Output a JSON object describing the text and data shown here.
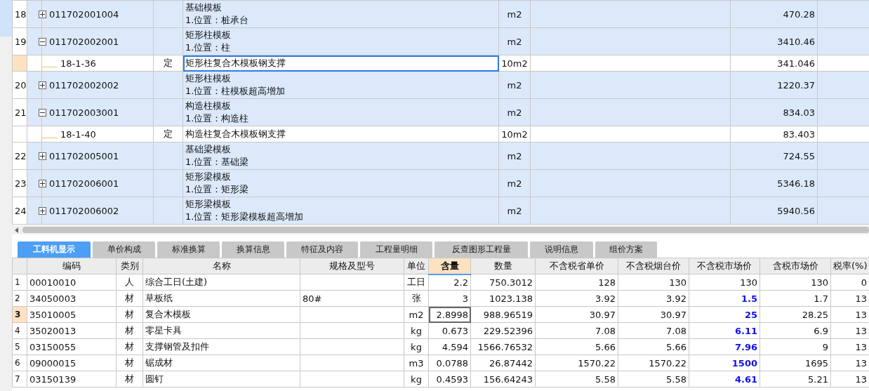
{
  "top_grid": {
    "rows": [
      {
        "number": "18",
        "code": "011702001004",
        "expanded": false,
        "name": "基础模板",
        "feature": "1.位置：桩承台",
        "unit": "m2",
        "quantity": "470.28"
      },
      {
        "number": "19",
        "code": "011702002001",
        "expanded": true,
        "name": "矩形柱模板",
        "feature": "1.位置：柱",
        "unit": "m2",
        "quantity": "3410.46",
        "children": [
          {
            "code": "18-1-36",
            "type": "定",
            "name": "矩形柱复合木模板钢支撑",
            "unit": "10m2",
            "quantity": "341.046",
            "selected": true
          }
        ]
      },
      {
        "number": "20",
        "code": "011702002002",
        "expanded": false,
        "name": "矩形柱模板",
        "feature": "1.位置：柱模板超高增加",
        "unit": "m2",
        "quantity": "1220.37"
      },
      {
        "number": "21",
        "code": "011702003001",
        "expanded": true,
        "name": "构造柱模板",
        "feature": "1.位置：构造柱",
        "unit": "m2",
        "quantity": "834.03",
        "children": [
          {
            "code": "18-1-40",
            "type": "定",
            "name": "构造柱复合木模板钢支撑",
            "unit": "10m2",
            "quantity": "83.403",
            "selected": false
          }
        ]
      },
      {
        "number": "22",
        "code": "011702005001",
        "expanded": false,
        "name": "基础梁模板",
        "feature": "1.位置：基础梁",
        "unit": "m2",
        "quantity": "724.55"
      },
      {
        "number": "23",
        "code": "011702006001",
        "expanded": false,
        "name": "矩形梁模板",
        "feature": "1.位置：矩形梁",
        "unit": "m2",
        "quantity": "5346.18"
      },
      {
        "number": "24",
        "code": "011702006002",
        "expanded": false,
        "name": "矩形梁模板",
        "feature": "1.位置：矩形梁模板超高增加",
        "unit": "m2",
        "quantity": "5940.56"
      }
    ]
  },
  "tabs": [
    {
      "label": "工料机显示",
      "selected": true
    },
    {
      "label": "单价构成",
      "selected": false
    },
    {
      "label": "标准换算",
      "selected": false
    },
    {
      "label": "换算信息",
      "selected": false
    },
    {
      "label": "特征及内容",
      "selected": false
    },
    {
      "label": "工程量明细",
      "selected": false
    },
    {
      "label": "反查图形工程量",
      "selected": false
    },
    {
      "label": "说明信息",
      "selected": false
    },
    {
      "label": "组价方案",
      "selected": false
    }
  ],
  "materials": {
    "columns": [
      {
        "label": "编码",
        "selected": false
      },
      {
        "label": "类别",
        "selected": false
      },
      {
        "label": "名称",
        "selected": false
      },
      {
        "label": "规格及型号",
        "selected": false
      },
      {
        "label": "单位",
        "selected": false
      },
      {
        "label": "含量",
        "selected": true
      },
      {
        "label": "数量",
        "selected": false
      },
      {
        "label": "不含税省单价",
        "selected": false
      },
      {
        "label": "不含税烟台价",
        "selected": false
      },
      {
        "label": "不含税市场价",
        "selected": false
      },
      {
        "label": "含税市场价",
        "selected": false
      },
      {
        "label": "税率(%)",
        "selected": false
      }
    ],
    "rows": [
      {
        "number": "1",
        "code": "00010010",
        "category": "人",
        "name": "综合工日(土建)",
        "spec": "",
        "unit": "工日",
        "content": "2.2",
        "quantity": "750.3012",
        "province_price": "128",
        "yantai_price": "130",
        "market_price": "130",
        "market_adjusted": false,
        "tax_market_price": "130",
        "tax_rate": "0",
        "selected": false
      },
      {
        "number": "2",
        "code": "34050003",
        "category": "材",
        "name": "草板纸",
        "spec": "80#",
        "unit": "张",
        "content": "3",
        "quantity": "1023.138",
        "province_price": "3.92",
        "yantai_price": "3.92",
        "market_price": "1.5",
        "market_adjusted": true,
        "tax_market_price": "1.7",
        "tax_rate": "13",
        "selected": false
      },
      {
        "number": "3",
        "code": "35010005",
        "category": "材",
        "name": "复合木模板",
        "spec": "",
        "unit": "m2",
        "content": "2.8998",
        "quantity": "988.96519",
        "province_price": "30.97",
        "yantai_price": "30.97",
        "market_price": "25",
        "market_adjusted": true,
        "tax_market_price": "28.25",
        "tax_rate": "13",
        "selected": true
      },
      {
        "number": "4",
        "code": "35020013",
        "category": "材",
        "name": "零星卡具",
        "spec": "",
        "unit": "kg",
        "content": "0.673",
        "quantity": "229.52396",
        "province_price": "7.08",
        "yantai_price": "7.08",
        "market_price": "6.11",
        "market_adjusted": true,
        "tax_market_price": "6.9",
        "tax_rate": "13",
        "selected": false
      },
      {
        "number": "5",
        "code": "03150055",
        "category": "材",
        "name": "支撑钢管及扣件",
        "spec": "",
        "unit": "kg",
        "content": "4.594",
        "quantity": "1566.76532",
        "province_price": "5.66",
        "yantai_price": "5.66",
        "market_price": "7.96",
        "market_adjusted": true,
        "tax_market_price": "9",
        "tax_rate": "13",
        "selected": false
      },
      {
        "number": "6",
        "code": "09000015",
        "category": "材",
        "name": "锯成材",
        "spec": "",
        "unit": "m3",
        "content": "0.0788",
        "quantity": "26.87442",
        "province_price": "1570.22",
        "yantai_price": "1570.22",
        "market_price": "1500",
        "market_adjusted": true,
        "tax_market_price": "1695",
        "tax_rate": "13",
        "selected": false
      },
      {
        "number": "7",
        "code": "03150139",
        "category": "材",
        "name": "圆钉",
        "spec": "",
        "unit": "kg",
        "content": "0.4593",
        "quantity": "156.64243",
        "province_price": "5.58",
        "yantai_price": "5.58",
        "market_price": "4.61",
        "market_adjusted": true,
        "tax_market_price": "5.21",
        "tax_rate": "13",
        "selected": false
      }
    ]
  }
}
